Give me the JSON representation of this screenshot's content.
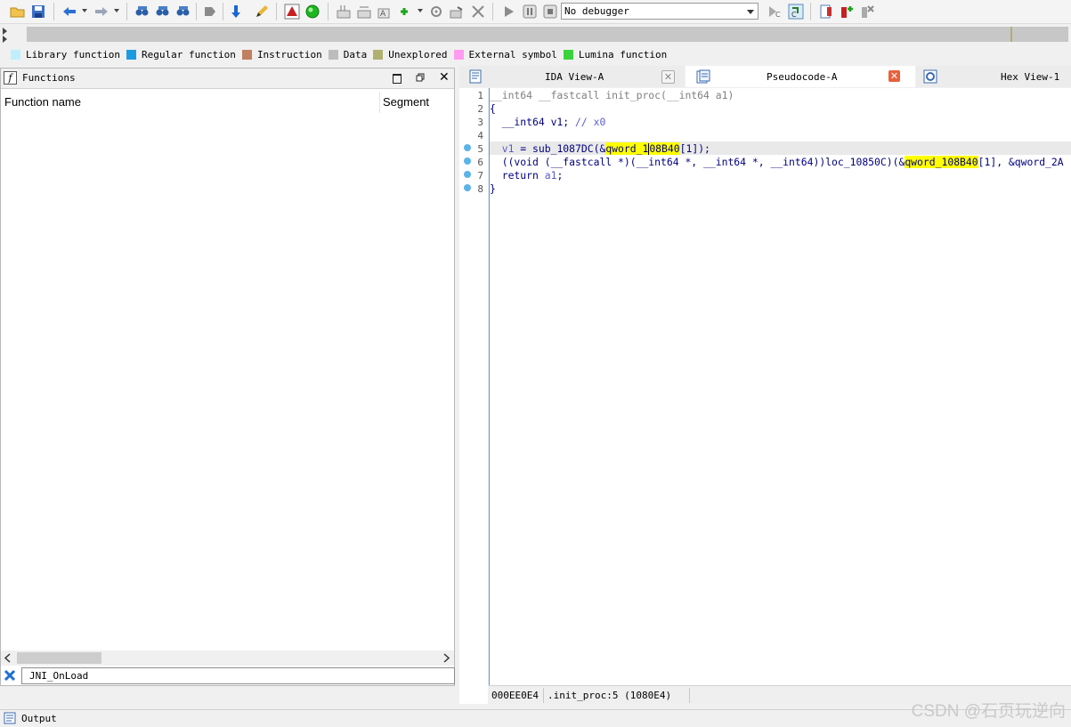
{
  "toolbar": {
    "debugger": "No debugger"
  },
  "legend": [
    {
      "label": "Library function",
      "color": "#bfefff"
    },
    {
      "label": "Regular function",
      "color": "#1e9be0"
    },
    {
      "label": "Instruction",
      "color": "#c08060"
    },
    {
      "label": "Data",
      "color": "#bcbcbc"
    },
    {
      "label": "Unexplored",
      "color": "#b0b070"
    },
    {
      "label": "External symbol",
      "color": "#ff9cf0"
    },
    {
      "label": "Lumina function",
      "color": "#3cd23c"
    }
  ],
  "functions_panel": {
    "title": "Functions",
    "col_name": "Function name",
    "col_segment": "Segment",
    "filter": "JNI_OnLoad"
  },
  "tabs": [
    {
      "label": "IDA View-A"
    },
    {
      "label": "Pseudocode-A"
    },
    {
      "label": "Hex View-1"
    }
  ],
  "code": {
    "line_numbers": [
      "1",
      "2",
      "3",
      "4",
      "5",
      "6",
      "7",
      "8"
    ],
    "l1": "__int64 __fastcall init_proc(__int64 a1)",
    "l2": "{",
    "l3a": "  __int64 v1; ",
    "l3b": "// x0",
    "l5a": "  v1",
    "l5b": " = sub_1087DC(&",
    "l5c": "qword_1",
    "l5d": "08B40",
    "l5e": "[1]);",
    "l6a": "  ((void (__fastcall *)(__int64 *, __int64 *, __int64))loc_10850C)(&",
    "l6b": "qword_108B40",
    "l6c": "[1], &qword_2A",
    "l7a": "  return ",
    "l7b": "a1",
    "l7c": ";",
    "l8": "}"
  },
  "status": {
    "address": "000EE0E4",
    "location": ".init_proc:5 (1080E4)"
  },
  "output": {
    "title": "Output"
  },
  "watermark": "CSDN @石页玩逆向"
}
